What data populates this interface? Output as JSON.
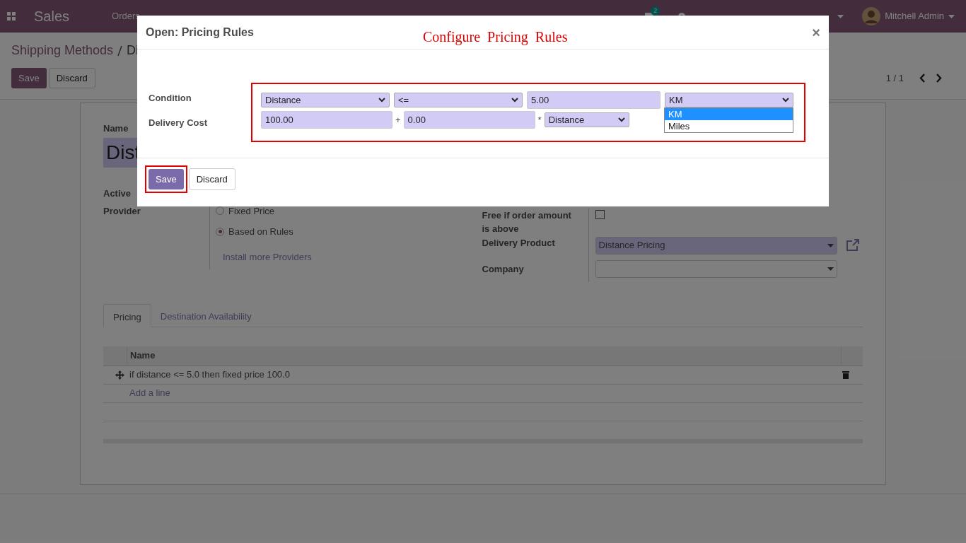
{
  "navbar": {
    "app_title": "Sales",
    "menu": [
      "Orders"
    ],
    "messages_badge": "2",
    "user": "Mitchell Admin"
  },
  "control_panel": {
    "breadcrumb": [
      "Shipping Methods",
      "Di"
    ],
    "buttons": [
      "Save",
      "Discard"
    ],
    "pager": "1 / 1"
  },
  "form": {
    "name_label": "Name",
    "name_value": "Dist",
    "active_label": "Active",
    "provider_label": "Provider",
    "provider_options": [
      {
        "label": "Fixed Price",
        "selected": false
      },
      {
        "label": "Based on Rules",
        "selected": true
      }
    ],
    "install_link": "Install more Providers",
    "free_if_above": {
      "label": "Free if order amount is above",
      "checked": false
    },
    "delivery_product": {
      "label": "Delivery Product",
      "value": "Distance Pricing"
    },
    "company": {
      "label": "Company"
    }
  },
  "tabs": [
    {
      "label": "Pricing",
      "selected": true
    },
    {
      "label": "Destination Availability",
      "selected": false
    }
  ],
  "table": {
    "columns": [
      "Name"
    ],
    "rows": [
      {
        "name": "if distance <= 5.0 then fixed price 100.0"
      }
    ],
    "add_line": "Add a line"
  },
  "dialog": {
    "title": "Open: Pricing Rules",
    "annotation": "Configure  Pricing  Rules",
    "close": "×",
    "condition": {
      "label": "Condition",
      "variable": "Distance",
      "operator": "<=",
      "value": "5.00",
      "unit": "KM",
      "unit_options": [
        {
          "label": "KM",
          "selected": true
        },
        {
          "label": "Miles",
          "selected": false
        }
      ]
    },
    "delivery_cost": {
      "label": "Delivery Cost",
      "fixed": "100.00",
      "plus": "+",
      "factor": "0.00",
      "times": "*",
      "factor_variable": "Distance"
    },
    "buttons": [
      "Save",
      "Discard"
    ]
  }
}
